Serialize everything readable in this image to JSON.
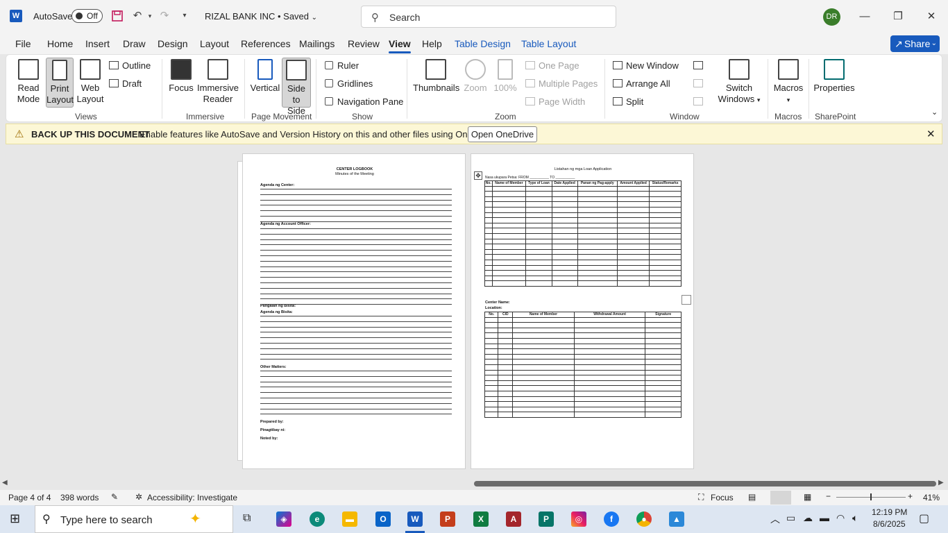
{
  "titlebar": {
    "app_icon": "W",
    "autosave_label": "AutoSave",
    "autosave_state": "Off",
    "save_icon": "save-icon",
    "undo_icon": "undo-icon",
    "redo_icon": "redo-icon",
    "doc_title": "RIZAL BANK INC • Saved",
    "search_placeholder": "Search",
    "avatar_initials": "DR"
  },
  "tabs": [
    "File",
    "Home",
    "Insert",
    "Draw",
    "Design",
    "Layout",
    "References",
    "Mailings",
    "Review",
    "View",
    "Help",
    "Table Design",
    "Table Layout"
  ],
  "active_tab": "View",
  "share_label": "Share",
  "ribbon": {
    "views": {
      "label": "Views",
      "read_mode": "Read Mode",
      "print_layout": "Print Layout",
      "web_layout": "Web Layout",
      "outline": "Outline",
      "draft": "Draft"
    },
    "immersive": {
      "label": "Immersive",
      "focus": "Focus",
      "immersive_reader": "Immersive Reader"
    },
    "page_movement": {
      "label": "Page Movement",
      "vertical": "Vertical",
      "side_to_side": "Side to Side"
    },
    "show": {
      "label": "Show",
      "ruler": "Ruler",
      "gridlines": "Gridlines",
      "navigation_pane": "Navigation Pane"
    },
    "zoom": {
      "label": "Zoom",
      "thumbnails": "Thumbnails",
      "zoom": "Zoom",
      "hundred": "100%",
      "one_page": "One Page",
      "multiple_pages": "Multiple Pages",
      "page_width": "Page Width"
    },
    "window": {
      "label": "Window",
      "new_window": "New Window",
      "arrange_all": "Arrange All",
      "split": "Split",
      "switch_windows": "Switch Windows"
    },
    "macros": {
      "label": "Macros",
      "macros": "Macros"
    },
    "sharepoint": {
      "label": "SharePoint",
      "properties": "Properties"
    }
  },
  "message_bar": {
    "title": "BACK UP THIS DOCUMENT",
    "text": "Enable features like AutoSave and Version History on this and other files using OneDrive.",
    "button": "Open OneDrive"
  },
  "page_left": {
    "title": "CENTER LOGBOOK",
    "subtitle": "Minutes of the Meeting",
    "agenda_center": "Agenda ng Center:",
    "agenda_ao": "Agenda ng Account Officer:",
    "pangalan_bisita": "Pangalan ng Bisita:",
    "agenda_bisita": "Agenda ng Bisita:",
    "other_matters": "Other Matters:",
    "prepared_by": "Prepared by:",
    "pinagtibay": "Pinagtibay ni:",
    "noted_by": "Noted by:"
  },
  "page_right": {
    "title": "Listahan ng mga Loan Application",
    "subtitle": "Nasa ukupara Petsa: FROM __________ TO __________",
    "loan_table": {
      "headers": [
        "No.",
        "Name of Member",
        "Type of Loan",
        "Date Applied",
        "Panan ng Pag-apply",
        "Amount Applied",
        "Status/Remarks"
      ],
      "rows": 19
    },
    "center_name": "Center Name:",
    "location": "Location:",
    "withdraw_table": {
      "headers": [
        "No.",
        "CID",
        "Name of Member",
        "Withdrawal Amount",
        "Signature"
      ],
      "rows": 19
    }
  },
  "statusbar": {
    "page": "Page 4 of 4",
    "words": "398 words",
    "accessibility": "Accessibility: Investigate",
    "focus": "Focus",
    "zoom": "41%"
  },
  "taskbar": {
    "search_placeholder": "Type here to search",
    "time": "12:19 PM",
    "date": "8/6/2025"
  }
}
